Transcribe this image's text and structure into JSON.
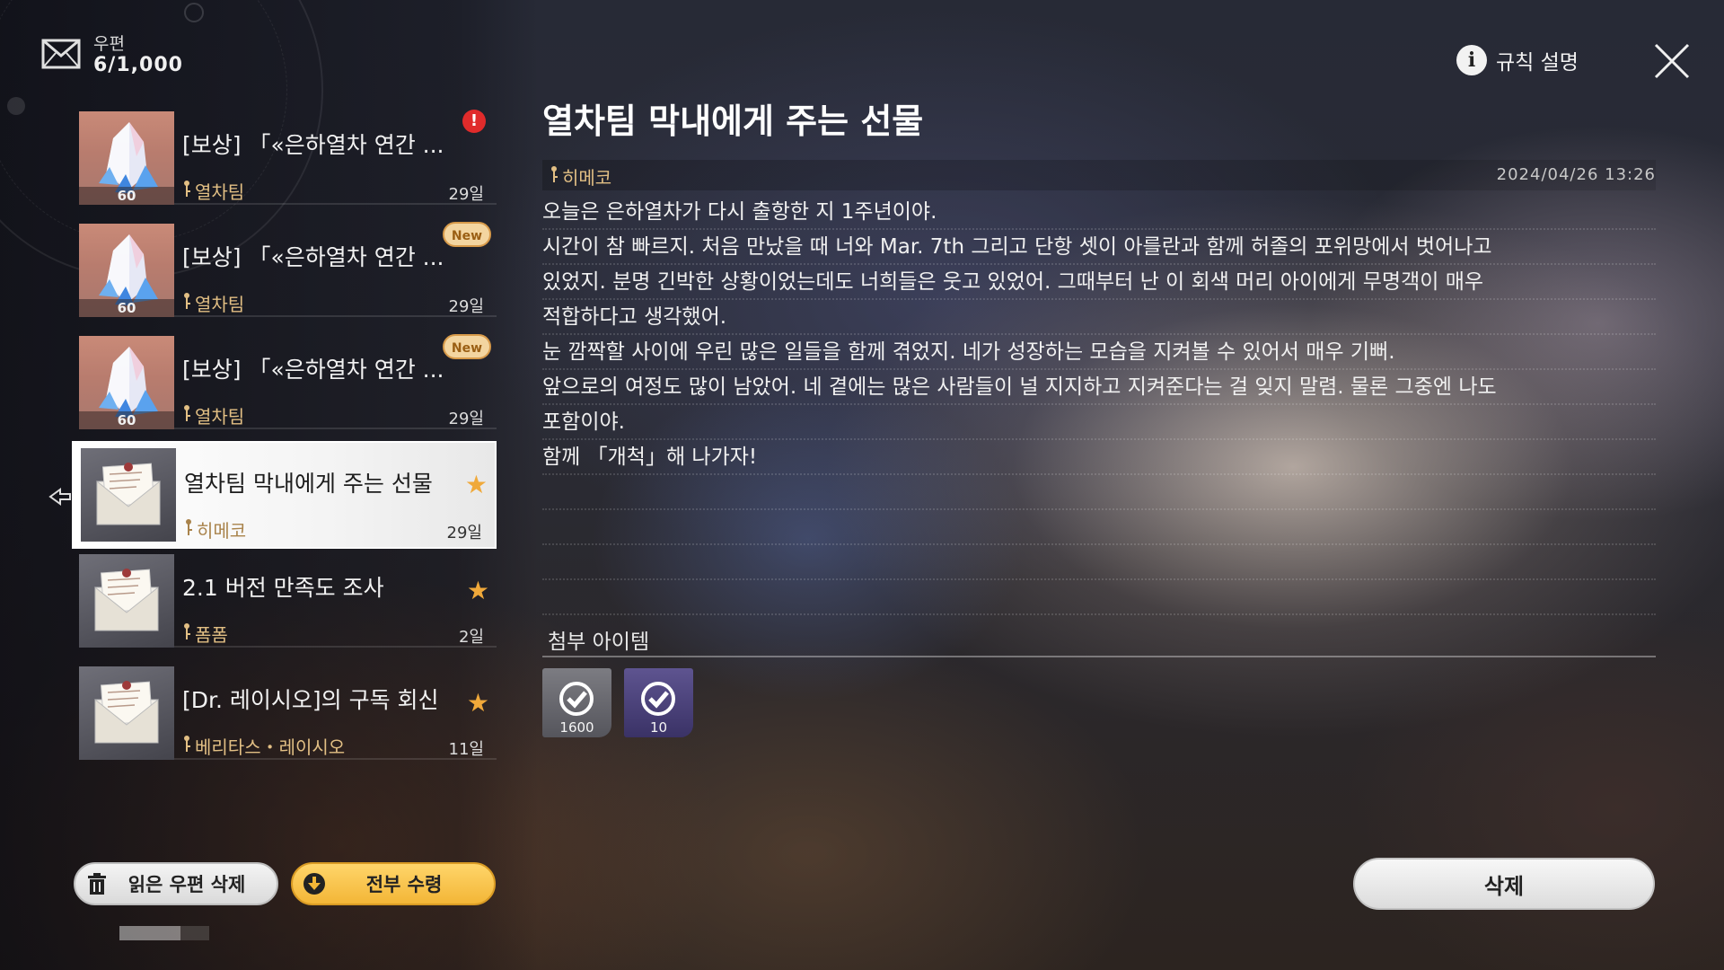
{
  "header": {
    "title": "우편",
    "count": "6/1,000"
  },
  "mails": [
    {
      "subject": "[보상] 「«은하열차 연간 ...",
      "sender": "열차팀",
      "days": "29일",
      "thumb": "crystal",
      "qty": "60",
      "badge": "!"
    },
    {
      "subject": "[보상] 「«은하열차 연간 ...",
      "sender": "열차팀",
      "days": "29일",
      "thumb": "crystal",
      "qty": "60",
      "badge": "New"
    },
    {
      "subject": "[보상] 「«은하열차 연간 ...",
      "sender": "열차팀",
      "days": "29일",
      "thumb": "crystal",
      "qty": "60",
      "badge": "New"
    },
    {
      "subject": "열차팀 막내에게 주는 선물",
      "sender": "히메코",
      "days": "29일",
      "thumb": "letter",
      "starred": true,
      "selected": true
    },
    {
      "subject": "2.1 버전 만족도 조사",
      "sender": "폼폼",
      "days": "2일",
      "thumb": "letter",
      "starred": true
    },
    {
      "subject": "[Dr. 레이시오]의 구독 회신",
      "sender": "베리타스・레이시오",
      "days": "11일",
      "thumb": "letter",
      "starred": true
    }
  ],
  "detail": {
    "title": "열차팀 막내에게 주는 선물",
    "sender": "히메코",
    "date": "2024/04/26 13:26",
    "body": [
      "오늘은 은하열차가 다시 출항한 지 1주년이야.",
      "시간이 참 빠르지. 처음 만났을 때 너와 Mar. 7th 그리고 단항 셋이 아를란과 함께 허졸의 포위망에서 벗어나고",
      "있었지. 분명 긴박한 상황이었는데도 너희들은 웃고 있었어. 그때부터 난 이 회색 머리 아이에게 무명객이 매우",
      "적합하다고 생각했어.",
      "눈 깜짝할 사이에 우린 많은 일들을 함께 겪었지. 네가 성장하는 모습을 지켜볼 수 있어서 매우 기뻐.",
      "앞으로의 여정도 많이 남았어. 네 곁에는 많은 사람들이 널 지지하고 지켜준다는 걸 잊지 말렴. 물론 그중엔 나도",
      "포함이야.",
      "함께 「개척」해 나가자!",
      "",
      "",
      "",
      ""
    ],
    "attachments_title": "첨부 아이템",
    "attachments": [
      {
        "qty": "1600",
        "style": "gray",
        "claimed": true
      },
      {
        "qty": "10",
        "style": "purple",
        "claimed": true
      }
    ]
  },
  "buttons": {
    "delete_read": "읽은 우편 삭제",
    "claim_all": "전부 수령",
    "delete": "삭제",
    "rules": "규칙 설명"
  },
  "colors": {
    "accent_gold": "#f3b637",
    "sender_gold": "#e2bf84",
    "star": "#f0a93a",
    "alert_red": "#e02b2b"
  }
}
